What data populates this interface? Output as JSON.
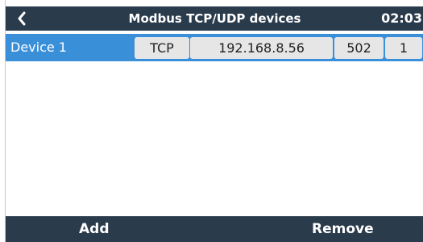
{
  "header": {
    "title": "Modbus TCP/UDP devices",
    "clock": "02:03",
    "back_icon": "chevron-left-icon"
  },
  "devices": [
    {
      "label": "Device 1",
      "protocol": "TCP",
      "ip": "192.168.8.56",
      "port": "502",
      "unit": "1"
    }
  ],
  "footer": {
    "add_label": "Add",
    "remove_label": "Remove"
  },
  "colors": {
    "header_bg": "#2a3b4c",
    "selected_row": "#3a8fd9",
    "field_bg": "#e6e6e6"
  }
}
